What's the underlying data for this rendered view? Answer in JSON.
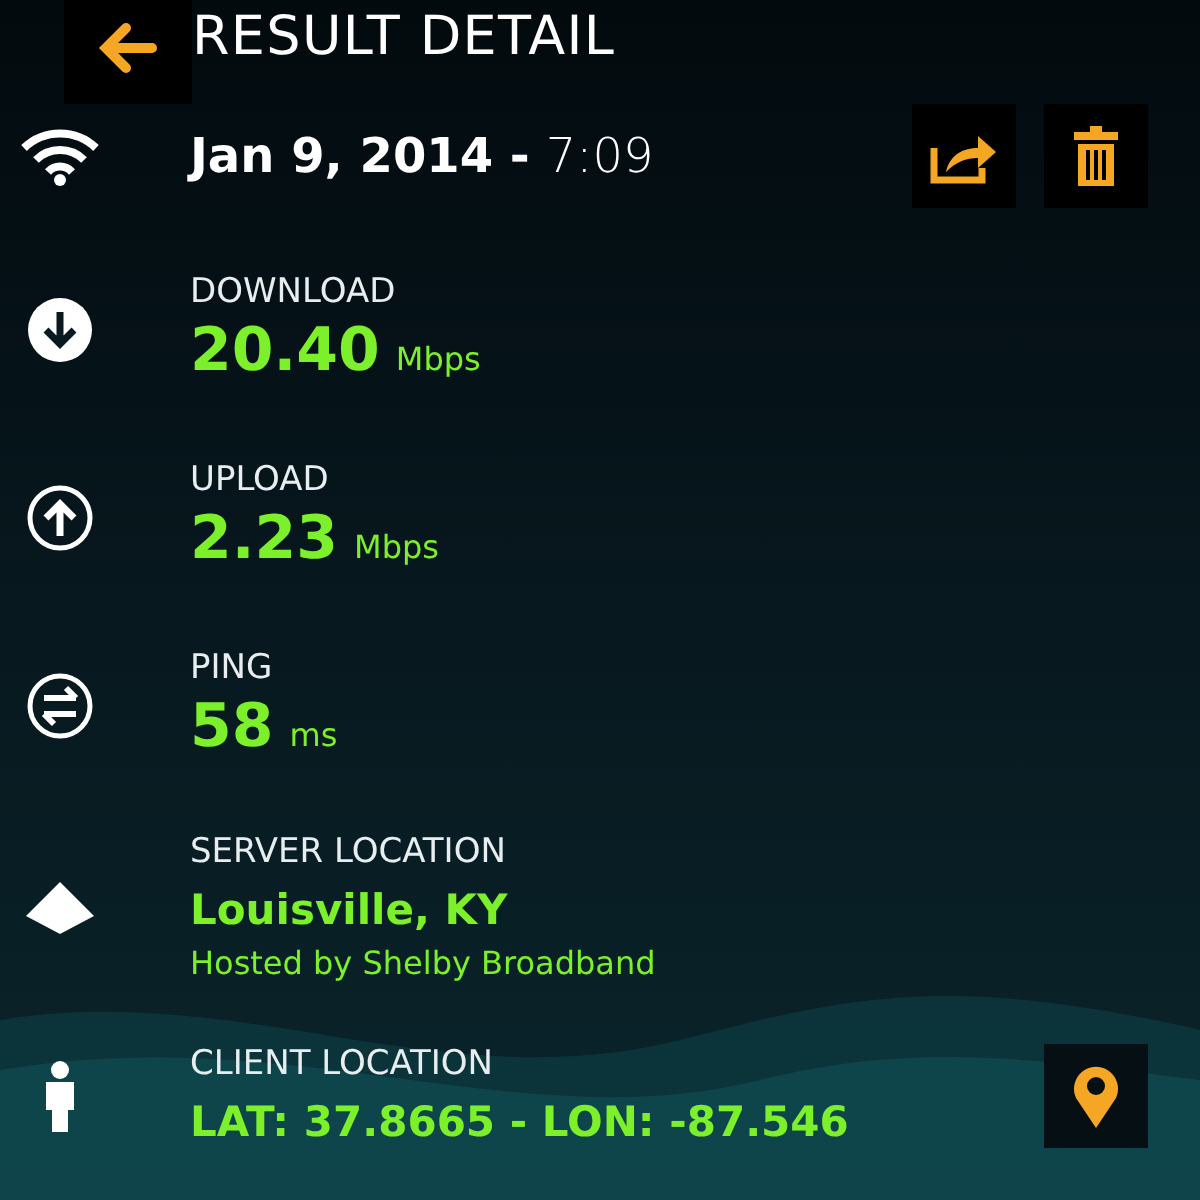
{
  "header": {
    "title": "RESULT DETAIL"
  },
  "result": {
    "date": "Jan 9, 2014 -",
    "time": "7:09"
  },
  "metrics": [
    {
      "kind": "download",
      "label": "DOWNLOAD",
      "value": "20.40",
      "unit": "Mbps"
    },
    {
      "kind": "upload",
      "label": "UPLOAD",
      "value": "2.23",
      "unit": "Mbps"
    },
    {
      "kind": "ping",
      "label": "PING",
      "value": "58",
      "unit": "ms"
    }
  ],
  "server": {
    "label": "SERVER LOCATION",
    "city": "Louisville, KY",
    "host": "Hosted by Shelby Broadband"
  },
  "client": {
    "label": "CLIENT LOCATION",
    "coords": "LAT: 37.8665 - LON: -87.546"
  }
}
